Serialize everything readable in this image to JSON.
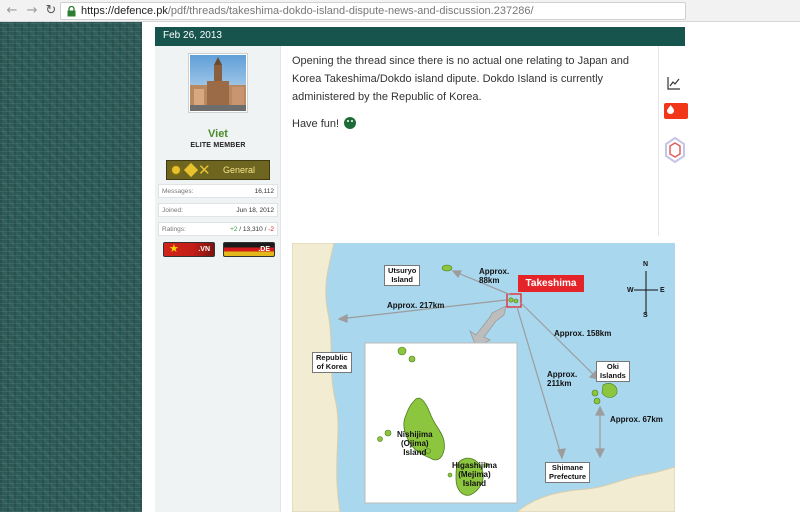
{
  "browser": {
    "url_host": "https://defence.pk",
    "url_path": "/pdf/threads/takeshima-dokdo-island-dispute-news-and-discussion.237286/"
  },
  "post": {
    "date": "Feb 26, 2013",
    "body": "Opening the thread since there is no actual one relating to Japan and Korea Takeshima/Dokdo island dipute. Dokdo Island is currently administered by the Republic of Korea.",
    "closing": "Have fun!"
  },
  "user": {
    "name": "Viet",
    "title": "ELITE MEMBER",
    "rank_label": "General",
    "stats": [
      {
        "key": "Messages:",
        "value": "16,112"
      },
      {
        "key": "Joined:",
        "value": "Jun 18, 2012"
      }
    ],
    "ratings": {
      "key": "Ratings:",
      "positive": "+2",
      "sep1": " / ",
      "neutral": "13,310",
      "sep2": " / ",
      "negative": "-2"
    },
    "flags": [
      {
        "label": ".VN"
      },
      {
        "label": ".DE"
      }
    ]
  },
  "map": {
    "takeshima": "Takeshima",
    "utsuryo": "Utsuryo\nIsland",
    "korea": "Republic\nof Korea",
    "oki": "Oki\nIslands",
    "shimane": "Shimane\nPrefecture",
    "nishijima": "Nishijima\n(Ojima)\nIsland",
    "higashijima": "Higashijima\n(Mejima)\nIsland",
    "dist_utsuryo": "Approx.\n88km",
    "dist_korea": "Approx. 217km",
    "dist_oki": "Approx. 158km",
    "dist_shimane": "Approx.\n211km",
    "dist_oki_shimane": "Approx. 67km",
    "compass": {
      "n": "N",
      "s": "S",
      "e": "E",
      "w": "W"
    }
  },
  "colors": {
    "date_bar": "#17544d",
    "sea": "#a9d7ee",
    "land": "#f1ecd2",
    "island": "#8cc63f",
    "takeshima_red": "#e5242a",
    "username_green": "#4a8a2a"
  },
  "icons": [
    "lock-icon",
    "back-icon",
    "forward-icon",
    "reload-icon",
    "chart-icon",
    "smiley-icon",
    "compass-icon"
  ]
}
